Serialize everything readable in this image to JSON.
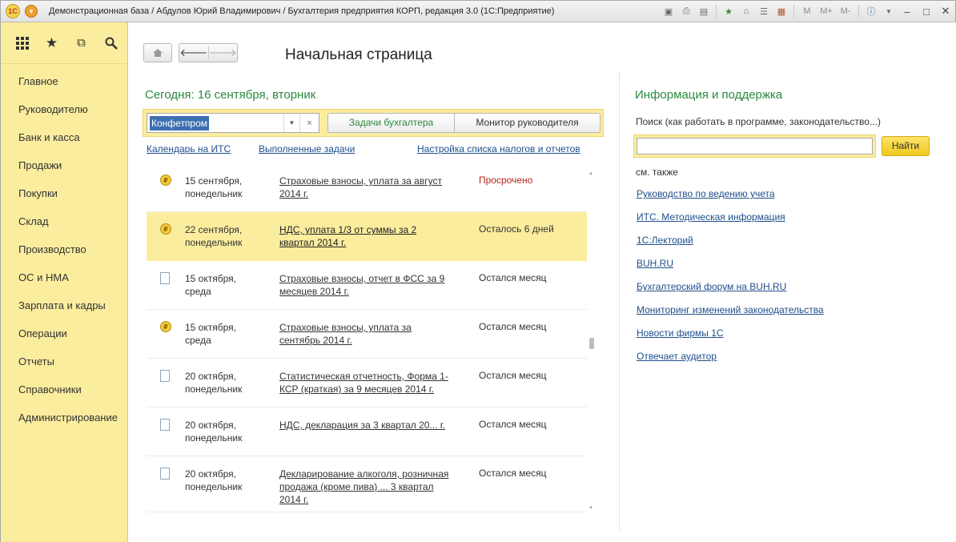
{
  "window": {
    "title": "Демонстрационная база / Абдулов Юрий Владимирович / Бухгалтерия предприятия КОРП, редакция 3.0  (1С:Предприятие)",
    "logo_text": "1С",
    "tools": [
      "M",
      "M+",
      "M-"
    ]
  },
  "sidebar": {
    "items": [
      {
        "label": "Главное"
      },
      {
        "label": "Руководителю"
      },
      {
        "label": "Банк и касса"
      },
      {
        "label": "Продажи"
      },
      {
        "label": "Покупки"
      },
      {
        "label": "Склад"
      },
      {
        "label": "Производство"
      },
      {
        "label": "ОС и НМА"
      },
      {
        "label": "Зарплата и кадры"
      },
      {
        "label": "Операции"
      },
      {
        "label": "Отчеты"
      },
      {
        "label": "Справочники"
      },
      {
        "label": "Администрирование"
      }
    ]
  },
  "main": {
    "page_title": "Начальная страница",
    "today": "Сегодня: 16 сентября, вторник",
    "organization": "Конфетпром",
    "tabs": {
      "active": "Задачи бухгалтера",
      "other": "Монитор руководителя"
    },
    "links": {
      "calendar": "Календарь на ИТС",
      "done": "Выполненные задачи",
      "taxes": "Настройка списка налогов и отчетов"
    },
    "tasks": [
      {
        "icon": "coin",
        "date": "15 сентября,\nпонедельник",
        "name": "Страховые взносы, уплата за август 2014 г.",
        "status": "Просрочено",
        "overdue": true
      },
      {
        "icon": "coin",
        "date": "22 сентября,\nпонедельник",
        "name": "НДС, уплата 1/3 от суммы за 2 квартал 2014 г.",
        "status": "Осталось 6 дней",
        "selected": true
      },
      {
        "icon": "doc",
        "date": "15 октября,\nсреда",
        "name": "Страховые взносы, отчет в ФСС за 9 месяцев 2014 г.",
        "status": "Остался месяц"
      },
      {
        "icon": "coin",
        "date": "15 октября,\nсреда",
        "name": "Страховые взносы, уплата за сентябрь 2014 г.",
        "status": "Остался месяц"
      },
      {
        "icon": "doc",
        "date": "20 октября,\nпонедельник",
        "name": "Статистическая отчетность, Форма 1-КСР (краткая) за 9 месяцев 2014 г.",
        "status": "Остался месяц"
      },
      {
        "icon": "doc",
        "date": "20 октября,\nпонедельник",
        "name": "НДС, декларация за 3 квартал 20... г.",
        "status": "Остался месяц"
      },
      {
        "icon": "doc",
        "date": "20 октября,\nпонедельник",
        "name": "Декларирование алкоголя, розничная продажа (кроме пива) ... 3 квартал 2014 г.",
        "status": "Остался месяц"
      }
    ]
  },
  "info": {
    "title": "Информация и поддержка",
    "search_label": "Поиск (как работать в программе, законодательство...)",
    "search_value": "",
    "find_button": "Найти",
    "see_also": "см. также",
    "links": [
      "Руководство по ведению учета",
      "ИТС. Методическая информация",
      "1С:Лекторий",
      "BUH.RU",
      "Бухгалтерский форум на BUH.RU",
      "Мониторинг изменений законодательства",
      "Новости фирмы 1С",
      "Отвечает аудитор"
    ]
  }
}
